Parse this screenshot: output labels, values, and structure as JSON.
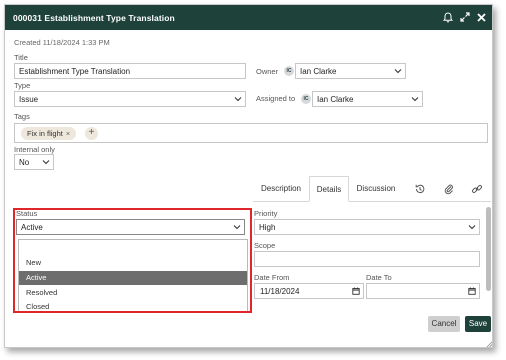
{
  "window": {
    "title": "000031 Establishment Type Translation",
    "icons": [
      "bell-icon",
      "expand-icon",
      "close-icon"
    ]
  },
  "meta": {
    "created": "Created 11/18/2024 1:33 PM"
  },
  "form": {
    "title_label": "Title",
    "title_value": "Establishment Type Translation",
    "owner_label": "Owner",
    "owner_value": "Ian Clarke",
    "owner_avatar": "IC",
    "type_label": "Type",
    "type_value": "Issue",
    "assigned_label": "Assigned to",
    "assigned_value": "Ian Clarke",
    "assigned_avatar": "IC",
    "tags_label": "Tags",
    "tags": [
      "Fix in flight"
    ],
    "tag_remove": "×",
    "tag_add": "+",
    "internal_label": "Internal only",
    "internal_value": "No"
  },
  "tabs": {
    "description": "Description",
    "details": "Details",
    "discussion": "Discussion",
    "icons": [
      "history-icon",
      "attachment-icon",
      "link-icon"
    ],
    "active": "Details"
  },
  "details": {
    "status_label": "Status",
    "status_value": "Active",
    "status_options": [
      "New",
      "Active",
      "Resolved",
      "Closed"
    ],
    "status_selected": "Active",
    "priority_label": "Priority",
    "priority_value": "High",
    "scope_label": "Scope",
    "scope_value": "",
    "date_from_label": "Date From",
    "date_from_value": "11/18/2024",
    "date_to_label": "Date To",
    "date_to_value": ""
  },
  "buttons": {
    "cancel": "Cancel",
    "save": "Save"
  },
  "colors": {
    "header": "#1e4239",
    "save": "#1e4239",
    "highlight": "#e0262a",
    "selected_option": "#6d6d6d",
    "chip": "#eee7dc"
  }
}
